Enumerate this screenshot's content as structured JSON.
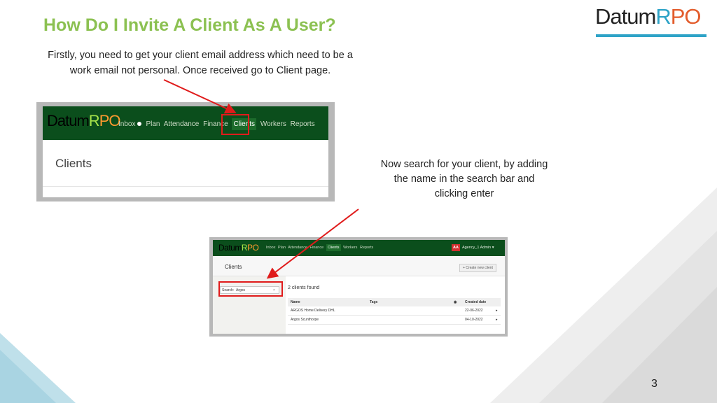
{
  "slide": {
    "title": "How Do I Invite A Client As A User?",
    "intro": "Firstly, you need to get your client email address which need to be a work email not personal. Once received go to Client page.",
    "search_note": "Now search for your client, by adding the name in the search bar and clicking enter",
    "page_number": "3"
  },
  "logo": {
    "part1": "Datum",
    "part2": "R",
    "part3": "PO"
  },
  "screenshot1": {
    "brand": {
      "part1": "Datum",
      "part2": "R",
      "part3": "PO"
    },
    "nav": {
      "inbox": "Inbox",
      "plan": "Plan",
      "attendance": "Attendance",
      "finance": "Finance",
      "clients": "Clients",
      "workers": "Workers",
      "reports": "Reports"
    },
    "page_title": "Clients"
  },
  "screenshot2": {
    "brand": {
      "part1": "Datum",
      "part2": "R",
      "part3": "PO"
    },
    "nav": {
      "inbox": "Inbox",
      "plan": "Plan",
      "attendance": "Attendance",
      "finance": "Finance",
      "clients": "Clients",
      "workers": "Workers",
      "reports": "Reports"
    },
    "user": {
      "initials": "AA",
      "name": "Agency_1 Admin",
      "caret": "▾"
    },
    "page_title": "Clients",
    "create_button": "+ Create new client",
    "search": {
      "label": "Search:",
      "value": "Argos",
      "clear": "×"
    },
    "results_count": "2 clients found",
    "table": {
      "headers": {
        "name": "Name",
        "tags": "Tags",
        "eye": "◉",
        "created": "Created date"
      },
      "rows": [
        {
          "name": "ARGOS Home Delivery DHL",
          "tags": "",
          "created": "22-06-2022",
          "arrow": "▸"
        },
        {
          "name": "Argos Scunthorpe",
          "tags": "",
          "created": "04-10-2022",
          "arrow": "▸"
        }
      ]
    }
  },
  "colors": {
    "title_green": "#8cc152",
    "logo_blue": "#2ea3c7",
    "logo_orange": "#e35d2d",
    "nav_green": "#0b4e1c",
    "highlight_red": "#e01b1b"
  }
}
